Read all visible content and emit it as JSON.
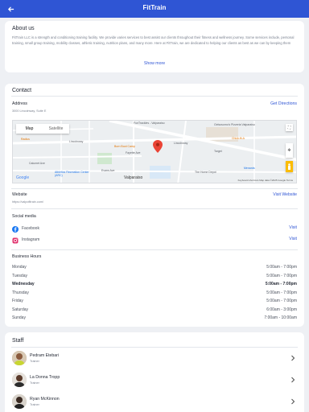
{
  "header": {
    "title": "FitTrain"
  },
  "about": {
    "title": "About us",
    "text": "FitTrain LLC is a strength and conditioning training facility. We provide varies services to best assist our clients throughout their fitness and wellness journey. Some services include, personal training, small group training, mobility classes, athletic training, nutrition plans, and many more. Here at FitTrain, we are dedicated to helping our clients as best as we can by keeping them accountable, personalizing workout plans and meal plans, and...",
    "show_more": "Show more"
  },
  "contact": {
    "title": "Contact",
    "address_label": "Address",
    "address": "3000 Lincolnway, Suite E",
    "directions": "Get Directions",
    "map": {
      "map_tab": "Map",
      "satellite_tab": "Satellite",
      "labels": [
        "FunTrackles - Valparaiso",
        "Gelsosomo's Pizzeria Valparaiso",
        "Lincolnway",
        "Lincolnway",
        "Radius",
        "Burn Boot Camp",
        "Target",
        "Chick-fil-A",
        "Menards",
        "Fayette Ave",
        "Evans Ave",
        "Calumet Ave",
        "Athletics Recreation Center (ARC)",
        "Valparaiso",
        "The Home Depot",
        "Google"
      ],
      "footer": "Keyboard shortcuts   Map data ©2025 Google   Terms"
    },
    "website_label": "Website",
    "website": "https://valpofitrain.com/",
    "visit_website": "Visit Website",
    "social_label": "Social media",
    "social": [
      {
        "name": "Facebook",
        "action": "Visit",
        "icon": "facebook-icon",
        "color": "#1877f2"
      },
      {
        "name": "Instagram",
        "action": "Visit",
        "icon": "instagram-icon",
        "color": "#e1306c"
      }
    ],
    "hours_label": "Business Hours",
    "hours": [
      {
        "day": "Monday",
        "time": "5:00am - 7:00pm"
      },
      {
        "day": "Tuesday",
        "time": "5:00am - 7:00pm"
      },
      {
        "day": "Wednesday",
        "time": "5:00am - 7:00pm"
      },
      {
        "day": "Thursday",
        "time": "5:00am - 7:00pm"
      },
      {
        "day": "Friday",
        "time": "5:00am - 7:00pm"
      },
      {
        "day": "Saturday",
        "time": "6:00am - 3:00pm"
      },
      {
        "day": "Sunday",
        "time": "7:00am - 10:00am"
      }
    ]
  },
  "staff": {
    "title": "Staff",
    "members": [
      {
        "name": "Pedram Etebari",
        "role": "Trainer"
      },
      {
        "name": "La Donna Tropp",
        "role": "Trainer"
      },
      {
        "name": "Ryan McKinnon",
        "role": "Trainer"
      }
    ]
  },
  "colors": {
    "accent": "#2f55d4",
    "background": "#eef0f4"
  }
}
